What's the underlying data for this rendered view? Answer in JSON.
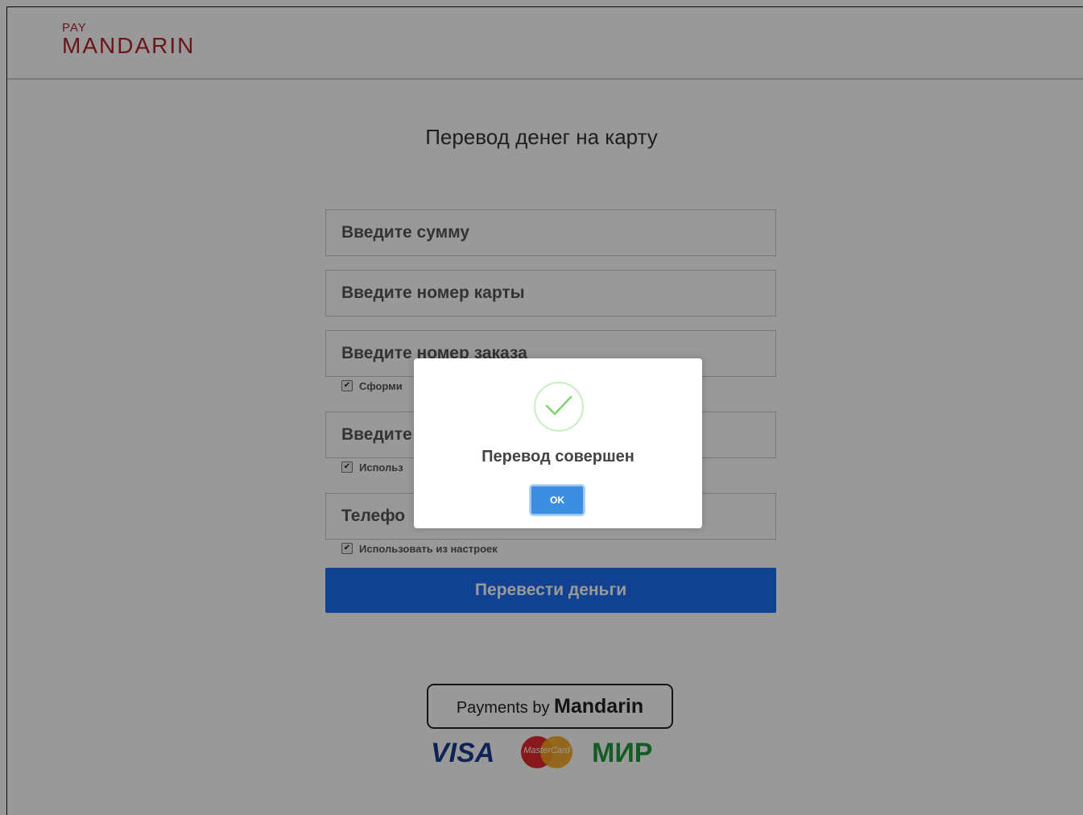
{
  "logo": {
    "pay": "PAY",
    "brand": "MANDARIN"
  },
  "page": {
    "title": "Перевод денег на карту"
  },
  "form": {
    "amount_placeholder": "Введите сумму",
    "card_placeholder": "Введите номер карты",
    "order_placeholder": "Введите номер заказа",
    "order_checkbox_label": "Сформи",
    "email_placeholder": "Введите",
    "email_checkbox_label": "Использ",
    "phone_placeholder": "Телефо",
    "phone_checkbox_label": "Использовать из настроек",
    "submit_label": "Перевести деньги"
  },
  "footer": {
    "payments_prefix": "Payments by ",
    "payments_brand": "Mandarin",
    "card_visa": "VISA",
    "card_mastercard": "MasterCard",
    "card_mir": "МИР"
  },
  "dialog": {
    "message": "Перевод совершен",
    "ok_label": "OK",
    "icon": "success-check-icon"
  },
  "colors": {
    "brand_red": "#b3242a",
    "submit_blue": "#1c6ef2",
    "ok_blue": "#3b8ee0",
    "check_green": "#7dd36f"
  }
}
